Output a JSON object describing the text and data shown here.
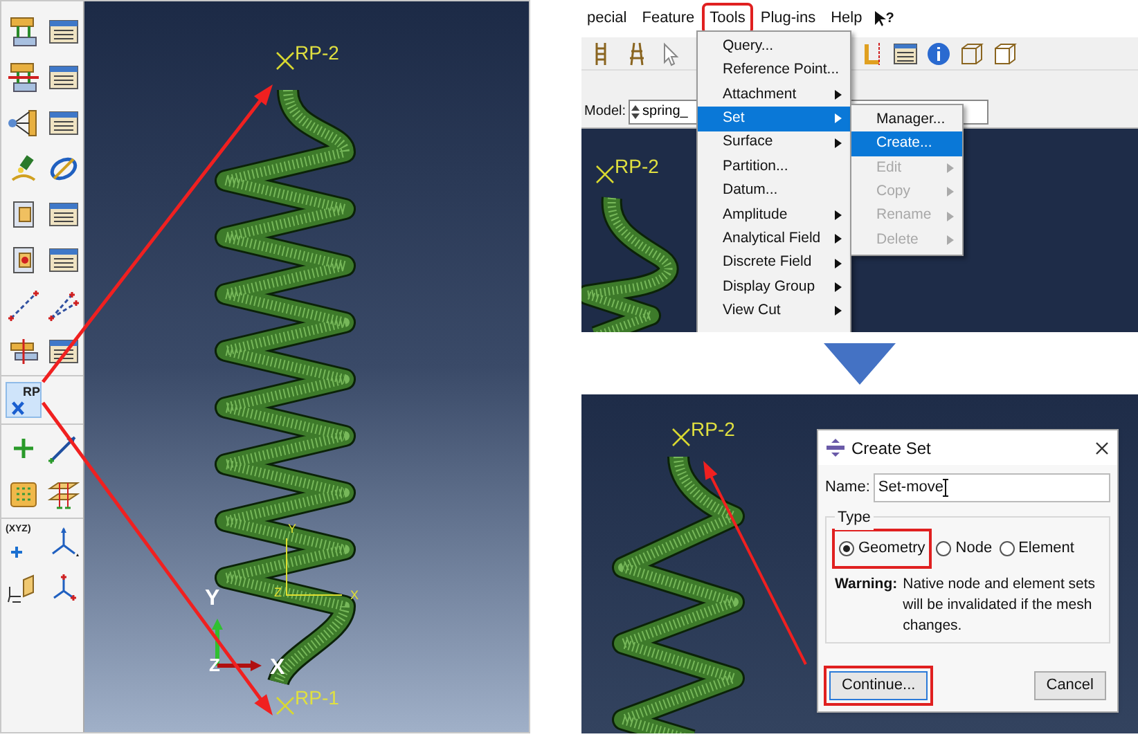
{
  "left_screenshot": {
    "tool_groups": [
      {
        "tools": [
          {
            "kind": "constraint-pair",
            "selected": false
          },
          {
            "kind": "manager",
            "selected": false
          },
          {
            "kind": "constraint-cut",
            "selected": false
          },
          {
            "kind": "manager",
            "selected": false
          },
          {
            "kind": "coupling",
            "selected": false
          },
          {
            "kind": "manager",
            "selected": false
          },
          {
            "kind": "lamp",
            "selected": false
          },
          {
            "kind": "rotate",
            "selected": false
          },
          {
            "kind": "bracket",
            "selected": false
          },
          {
            "kind": "manager",
            "selected": false
          },
          {
            "kind": "bracket-dot",
            "selected": false
          },
          {
            "kind": "manager",
            "selected": false
          },
          {
            "kind": "wire",
            "selected": false
          },
          {
            "kind": "wire-double",
            "selected": false
          },
          {
            "kind": "plates",
            "selected": false
          },
          {
            "kind": "manager",
            "selected": false
          }
        ]
      },
      {
        "tools": [
          {
            "kind": "reference-point",
            "label": "RP",
            "selected": true
          }
        ]
      },
      {
        "tools": [
          {
            "kind": "plus",
            "selected": false
          },
          {
            "kind": "arrow-line",
            "selected": false
          },
          {
            "kind": "grid",
            "selected": false
          },
          {
            "kind": "planes",
            "selected": false
          }
        ]
      },
      {
        "tools": [
          {
            "kind": "point-xyz",
            "label": "(XYZ)",
            "selected": false
          },
          {
            "kind": "axes",
            "selected": false
          },
          {
            "kind": "plane-axes",
            "selected": false
          },
          {
            "kind": "triad",
            "selected": false
          }
        ]
      }
    ],
    "viewport": {
      "top_point": "RP-2",
      "bottom_point": "RP-1",
      "csys_labels": [
        "Y",
        "Z",
        "X"
      ],
      "triad_labels": [
        "Y",
        "Z",
        "X"
      ]
    }
  },
  "top_right_screenshot": {
    "menu_bar": [
      {
        "label": "pecial",
        "selected": false
      },
      {
        "label": "Feature",
        "selected": false
      },
      {
        "label": "Tools",
        "selected": true
      },
      {
        "label": "Plug-ins",
        "selected": false
      },
      {
        "label": "Help",
        "selected": false
      }
    ],
    "whats_this": "?",
    "model_label": "Model:",
    "model_value": "spring_",
    "viewport_point": "RP-2",
    "tools_menu": [
      {
        "label": "Query...",
        "submenu": false,
        "selected": false
      },
      {
        "label": "Reference Point...",
        "submenu": false,
        "selected": false
      },
      {
        "label": "Attachment",
        "submenu": true,
        "selected": false
      },
      {
        "label": "Set",
        "submenu": true,
        "selected": true
      },
      {
        "label": "Surface",
        "submenu": true,
        "selected": false
      },
      {
        "label": "Partition...",
        "submenu": false,
        "selected": false
      },
      {
        "label": "Datum...",
        "submenu": false,
        "selected": false
      },
      {
        "label": "Amplitude",
        "submenu": true,
        "selected": false
      },
      {
        "label": "Analytical Field",
        "submenu": true,
        "selected": false
      },
      {
        "label": "Discrete Field",
        "submenu": true,
        "selected": false
      },
      {
        "label": "Display Group",
        "submenu": true,
        "selected": false
      },
      {
        "label": "View Cut",
        "submenu": true,
        "selected": false
      }
    ],
    "set_submenu": [
      {
        "label": "Manager...",
        "submenu": false,
        "selected": false,
        "disabled": false
      },
      {
        "label": "Create...",
        "submenu": false,
        "selected": true,
        "disabled": false
      },
      {
        "label": "Edit",
        "submenu": true,
        "selected": false,
        "disabled": true
      },
      {
        "label": "Copy",
        "submenu": true,
        "selected": false,
        "disabled": true
      },
      {
        "label": "Rename",
        "submenu": true,
        "selected": false,
        "disabled": true
      },
      {
        "label": "Delete",
        "submenu": true,
        "selected": false,
        "disabled": true
      }
    ]
  },
  "bottom_right_screenshot": {
    "viewport_point": "RP-2",
    "dialog": {
      "title": "Create Set",
      "name_label": "Name:",
      "name_value": "Set-move",
      "type_label": "Type",
      "types": [
        {
          "label": "Geometry",
          "selected": true,
          "highlighted": true
        },
        {
          "label": "Node",
          "selected": false,
          "highlighted": false
        },
        {
          "label": "Element",
          "selected": false,
          "highlighted": false
        }
      ],
      "warning_label": "Warning:",
      "warning_text": "Native node and element sets will be invalidated if the mesh changes.",
      "buttons": [
        {
          "label": "Continue...",
          "highlighted": true
        },
        {
          "label": "Cancel",
          "highlighted": false
        }
      ]
    }
  }
}
